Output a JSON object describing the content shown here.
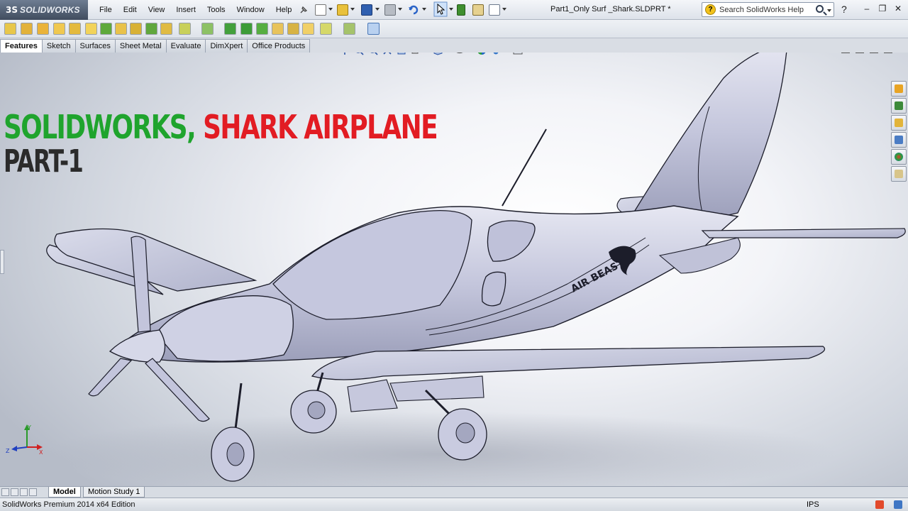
{
  "app": {
    "logo_text": "SOLIDWORKS",
    "logo_mark": "3S",
    "document_title": "Part1_Only Surf _Shark.SLDPRT *"
  },
  "menu": [
    "File",
    "Edit",
    "View",
    "Insert",
    "Tools",
    "Window",
    "Help"
  ],
  "search": {
    "placeholder": "Search SolidWorks Help",
    "help_glyph": "?"
  },
  "window_controls": {
    "help": "?",
    "minimize": "–",
    "restore": "❐",
    "close": "✕"
  },
  "command_tabs": [
    {
      "label": "Features",
      "active": true
    },
    {
      "label": "Sketch",
      "active": false
    },
    {
      "label": "Surfaces",
      "active": false
    },
    {
      "label": "Sheet Metal",
      "active": false
    },
    {
      "label": "Evaluate",
      "active": false
    },
    {
      "label": "DimXpert",
      "active": false
    },
    {
      "label": "Office Products",
      "active": false
    }
  ],
  "overlay": {
    "line1_green": "SOLIDWORKS,",
    "line1_red": "SHARK AIRPLANE",
    "line2": "PART-1"
  },
  "model": {
    "fuselage_text": "AIR BEAST"
  },
  "triad": {
    "y": "Y",
    "z": "Z",
    "x": "X"
  },
  "bottom_tabs": [
    {
      "label": "Model",
      "active": true
    },
    {
      "label": "Motion Study 1",
      "active": false
    }
  ],
  "status": {
    "edition": "SolidWorks Premium 2014 x64 Edition",
    "units": "IPS"
  },
  "colors": {
    "brand_green": "#1fa42d",
    "brand_red": "#e21c23",
    "model_surface": "#c9cbe0",
    "model_edge": "#1c1d2a"
  }
}
